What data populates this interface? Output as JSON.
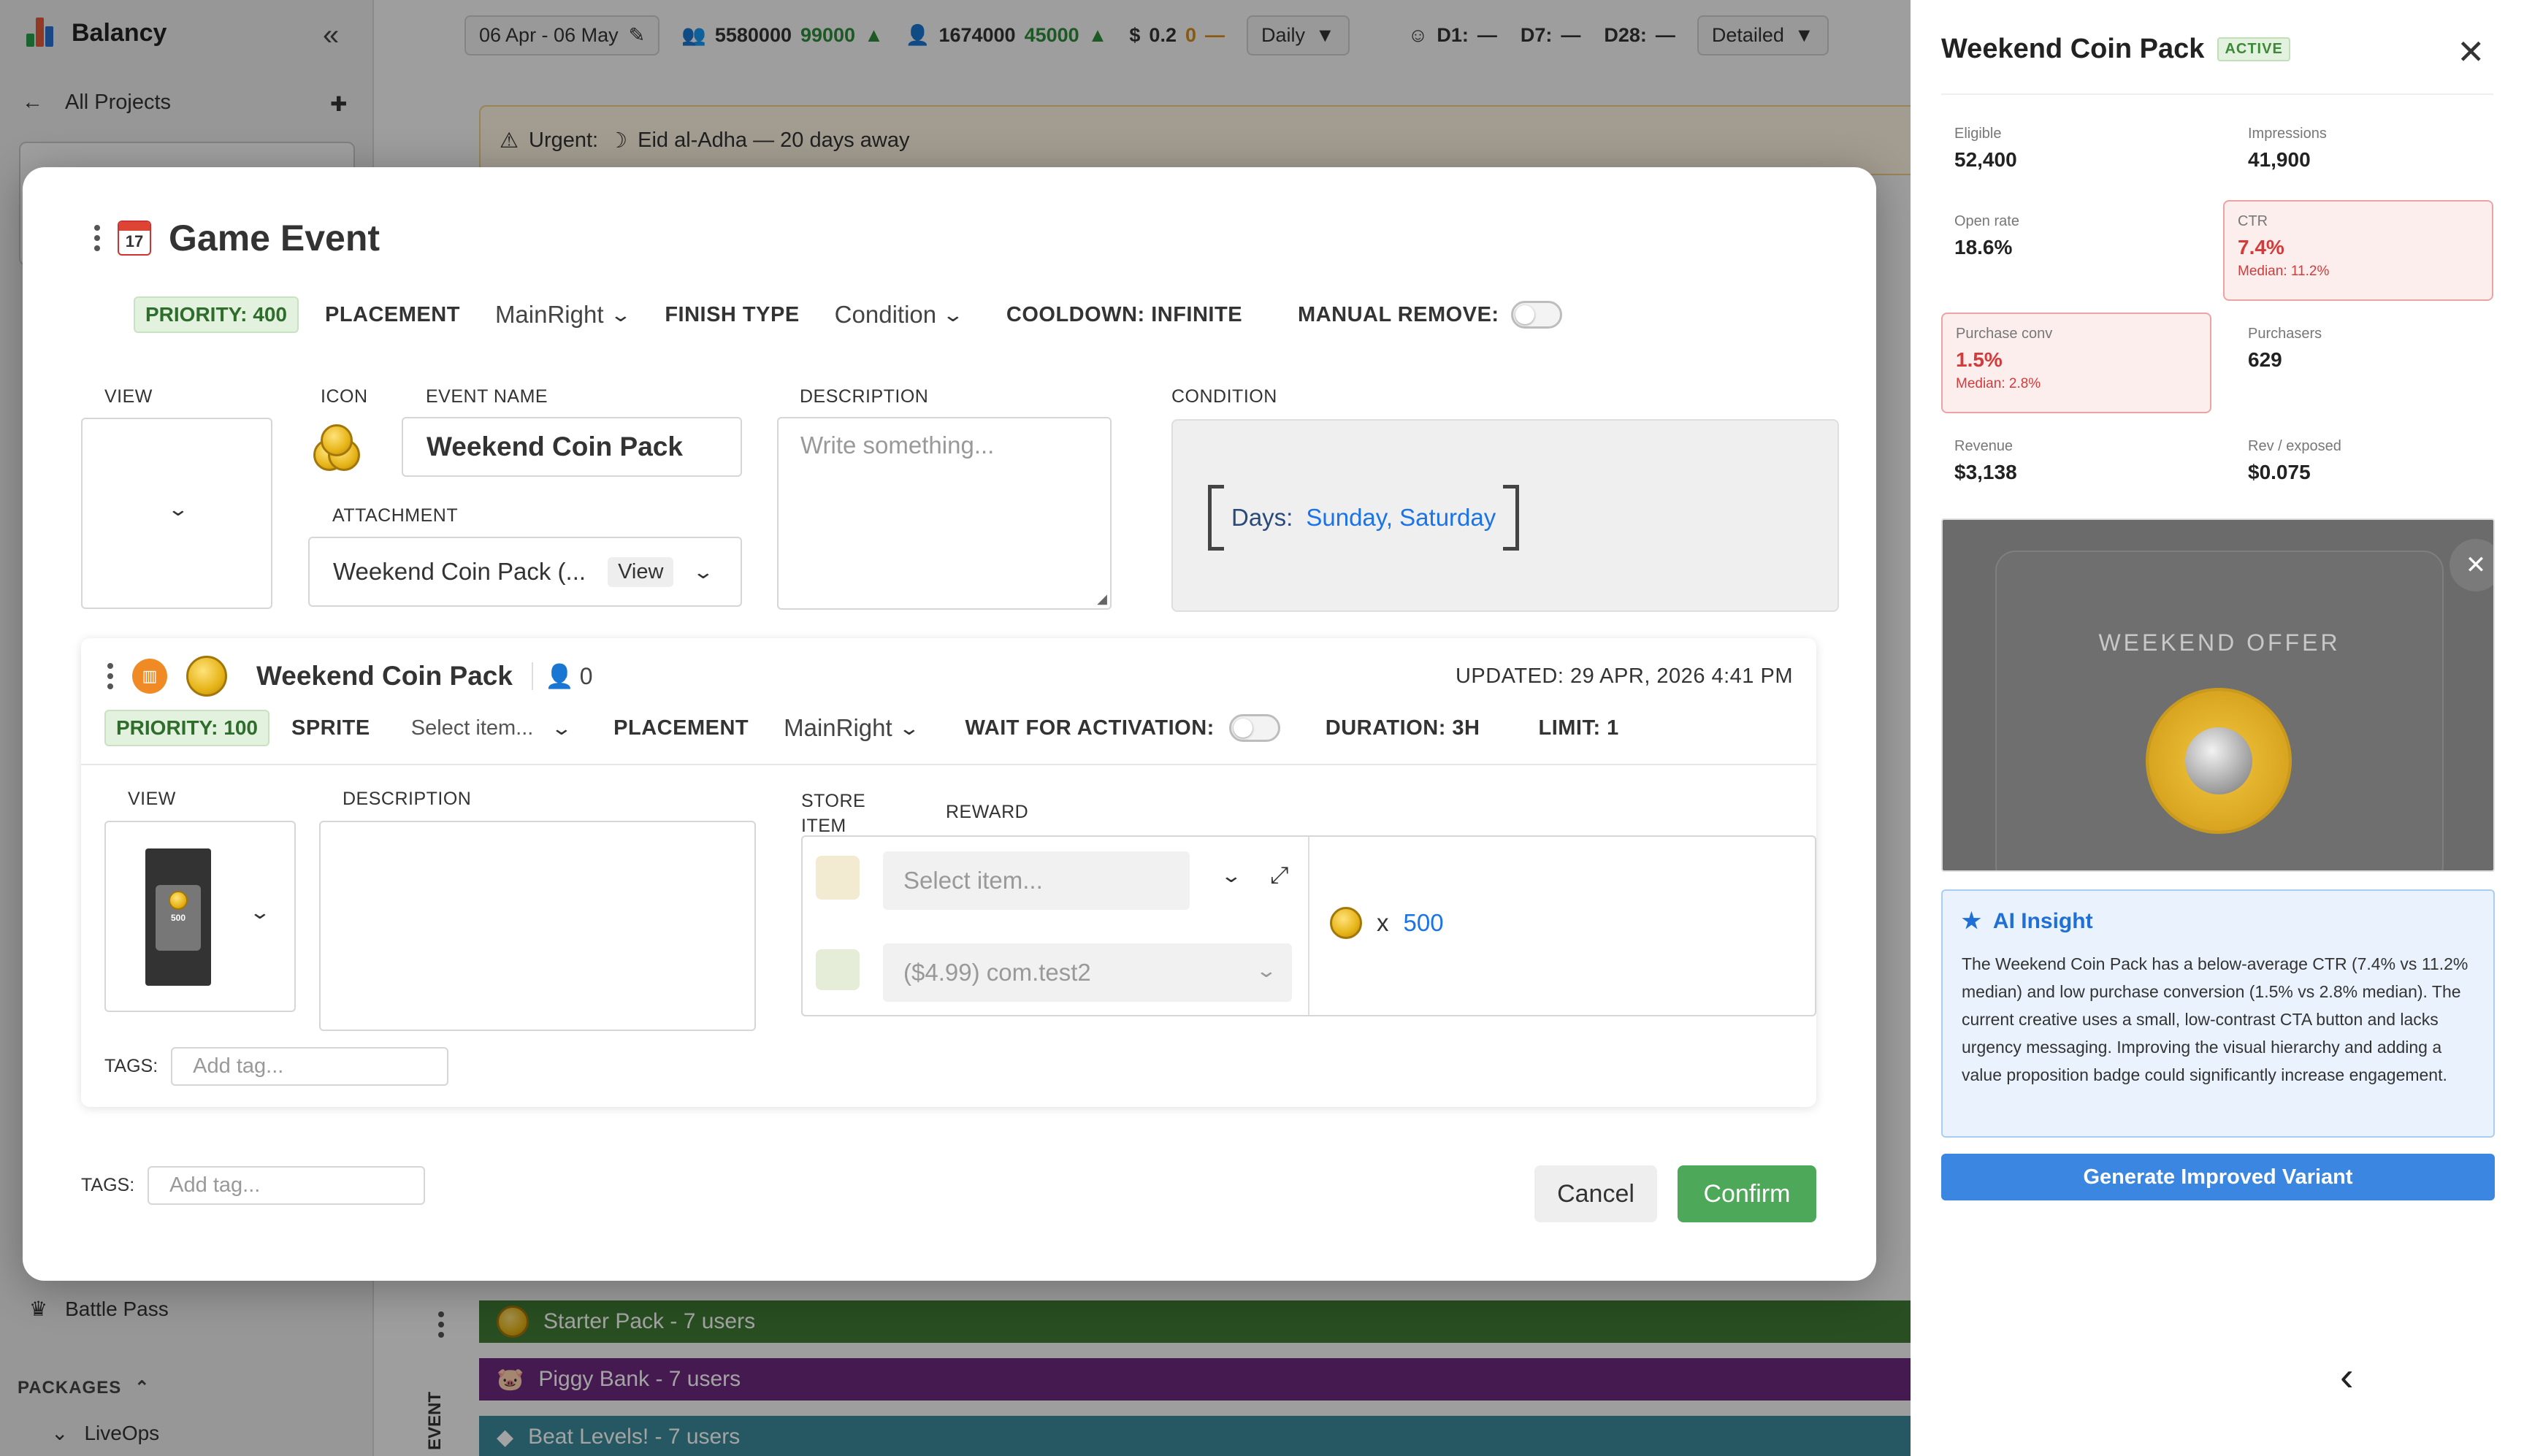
{
  "app": {
    "brand": "Balancy",
    "all_projects": "All Projects",
    "date_range": "06 Apr - 06 May",
    "metric_users": "5580000",
    "metric_users_delta": "99000",
    "metric_new": "1674000",
    "metric_new_delta": "45000",
    "metric_revenue": "0.2",
    "metric_revenue_delta": "0",
    "metric_revenue_dash": "—",
    "period": "Daily",
    "d1": "D1:",
    "d7": "D7:",
    "d28": "D28:",
    "dash": "—",
    "detail": "Detailed",
    "urgent_label": "Urgent:",
    "urgent_text": "Eid al-Adha — 20 days away",
    "sidebar_battle_pass": "Battle Pass",
    "sidebar_packages": "PACKAGES",
    "sidebar_liveops": "LiveOps",
    "event_vertical": "EVENT",
    "timeline": [
      {
        "label": "Starter Pack - 7 users",
        "color": "#3f7a35"
      },
      {
        "label": "Piggy Bank - 7 users",
        "color": "#6b2a7d"
      },
      {
        "label": "Beat Levels! - 7 users",
        "color": "#3a8a9a"
      }
    ]
  },
  "modal": {
    "title": "Game Event",
    "cal_day": "17",
    "priority": "PRIORITY: 400",
    "placement_label": "PLACEMENT",
    "placement_value": "MainRight",
    "finish_type_label": "FINISH TYPE",
    "finish_type_value": "Condition",
    "cooldown": "COOLDOWN: INFINITE",
    "manual_remove": "MANUAL REMOVE:",
    "view_label": "VIEW",
    "icon_label": "ICON",
    "event_name_label": "EVENT NAME",
    "event_name": "Weekend Coin Pack",
    "description_label": "DESCRIPTION",
    "description_placeholder": "Write something...",
    "condition_label": "CONDITION",
    "condition_days_label": "Days:",
    "condition_days": "Sunday, Saturday",
    "attachment_label": "ATTACHMENT",
    "attachment_value": "Weekend Coin Pack (...",
    "attachment_view": "View",
    "sub": {
      "name": "Weekend Coin Pack",
      "users": "0",
      "updated": "UPDATED: 29 APR, 2026 4:41 PM",
      "priority": "PRIORITY: 100",
      "sprite_label": "SPRITE",
      "sprite_placeholder": "Select item...",
      "placement_label": "PLACEMENT",
      "placement_value": "MainRight",
      "wait_label": "WAIT FOR ACTIVATION:",
      "duration": "DURATION: 3H",
      "limit": "LIMIT: 1",
      "view_label": "VIEW",
      "thumb_value": "500",
      "description_label": "DESCRIPTION",
      "store_item_label_1": "STORE",
      "store_item_label_2": "ITEM",
      "reward_label": "REWARD",
      "store_select_placeholder": "Select item...",
      "store_price_select": "($4.99) com.test2",
      "reward_x": "x",
      "reward_amount": "500",
      "tags_label": "TAGS:",
      "tags_placeholder": "Add tag..."
    },
    "tags_label": "TAGS:",
    "tags_placeholder": "Add tag...",
    "cancel": "Cancel",
    "confirm": "Confirm"
  },
  "panel": {
    "title": "Weekend Coin Pack",
    "badge": "ACTIVE",
    "stats": {
      "eligible_label": "Eligible",
      "eligible": "52,400",
      "impressions_label": "Impressions",
      "impressions": "41,900",
      "open_rate_label": "Open rate",
      "open_rate": "18.6%",
      "ctr_label": "CTR",
      "ctr": "7.4%",
      "ctr_median": "Median: 11.2%",
      "purchase_conv_label": "Purchase conv",
      "purchase_conv": "1.5%",
      "purchase_conv_median": "Median: 2.8%",
      "purchasers_label": "Purchasers",
      "purchasers": "629",
      "revenue_label": "Revenue",
      "revenue": "$3,138",
      "rev_exposed_label": "Rev / exposed",
      "rev_exposed": "$0.075"
    },
    "preview_text": "WEEKEND OFFER",
    "ai_title": "AI Insight",
    "ai_text": "The Weekend Coin Pack has a below-average CTR (7.4% vs 11.2% median) and low purchase conversion (1.5% vs 2.8% median). The current creative uses a small, low-contrast CTA button and lacks urgency messaging. Improving the visual hierarchy and adding a value proposition badge could significantly increase engagement.",
    "generate_button": "Generate Improved Variant"
  },
  "colors": {
    "accent_green": "#4ea85a",
    "accent_blue": "#3b86e0",
    "alert_red": "#d43a3a"
  }
}
